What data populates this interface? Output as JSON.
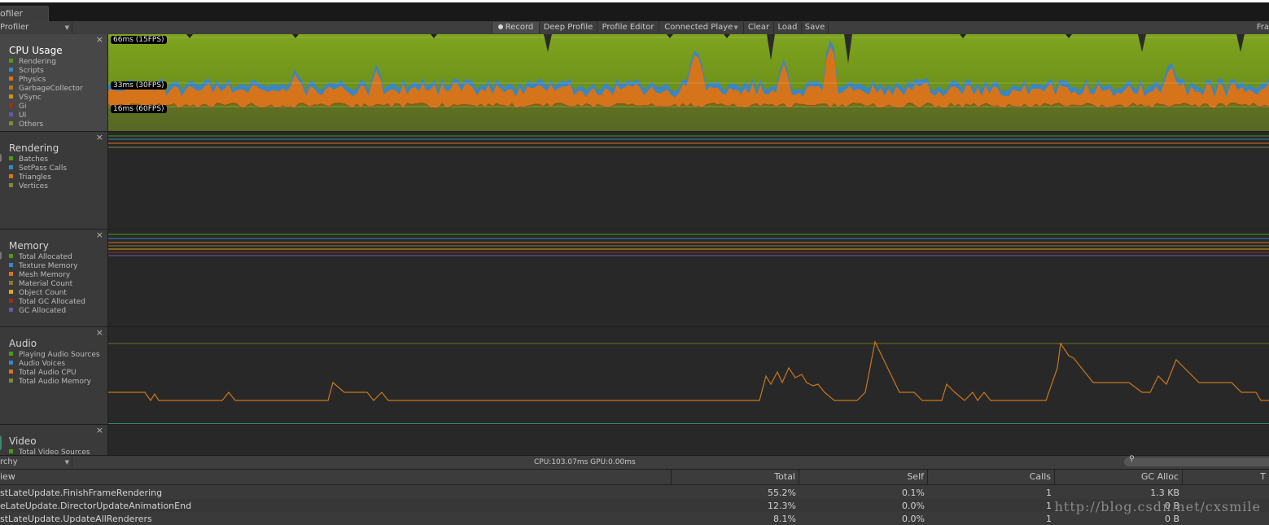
{
  "window": {
    "tab_title": "ofiler"
  },
  "toolbar": {
    "mode_dropdown": "Profiler",
    "record": "Record",
    "deep_profile": "Deep Profile",
    "profile_editor": "Profile Editor",
    "connected_player": "Connected Playe",
    "clear": "Clear",
    "load": "Load",
    "save": "Save",
    "frame_label": "Fra"
  },
  "lanes": [
    {
      "title": "CPU Usage",
      "selected": true,
      "legend": [
        {
          "label": "Rendering",
          "color": "#4c9a1c"
        },
        {
          "label": "Scripts",
          "color": "#3a86c4"
        },
        {
          "label": "Physics",
          "color": "#d6741b"
        },
        {
          "label": "GarbageCollector",
          "color": "#b07a20"
        },
        {
          "label": "VSync",
          "color": "#c9931a"
        },
        {
          "label": "Gi",
          "color": "#9c3018"
        },
        {
          "label": "UI",
          "color": "#6a56a8"
        },
        {
          "label": "Others",
          "color": "#7e8a38"
        }
      ],
      "fps_labels": [
        "66ms (15FPS)",
        "33ms (30FPS)",
        "16ms (60FPS)"
      ]
    },
    {
      "title": "Rendering",
      "selected": false,
      "legend": [
        {
          "label": "Batches",
          "color": "#4c9a1c"
        },
        {
          "label": "SetPass Calls",
          "color": "#3a86c4"
        },
        {
          "label": "Triangles",
          "color": "#d6741b"
        },
        {
          "label": "Vertices",
          "color": "#7e8a38"
        }
      ]
    },
    {
      "title": "Memory",
      "selected": false,
      "legend": [
        {
          "label": "Total Allocated",
          "color": "#4c9a1c"
        },
        {
          "label": "Texture Memory",
          "color": "#3a86c4"
        },
        {
          "label": "Mesh Memory",
          "color": "#d6741b"
        },
        {
          "label": "Material Count",
          "color": "#8a7a30"
        },
        {
          "label": "Object Count",
          "color": "#d8a81a"
        },
        {
          "label": "Total GC Allocated",
          "color": "#9c3018"
        },
        {
          "label": "GC Allocated",
          "color": "#6a56a8"
        }
      ]
    },
    {
      "title": "Audio",
      "selected": false,
      "legend": [
        {
          "label": "Playing Audio Sources",
          "color": "#4c9a1c"
        },
        {
          "label": "Audio Voices",
          "color": "#3a86c4"
        },
        {
          "label": "Total Audio CPU",
          "color": "#d6741b"
        },
        {
          "label": "Total Audio Memory",
          "color": "#7e8a38"
        }
      ]
    },
    {
      "title": "Video",
      "selected": false,
      "legend": [
        {
          "label": "Total Video Sources",
          "color": "#4c9a1c"
        }
      ]
    }
  ],
  "lane_close_glyph": "×",
  "hierarchy": {
    "view_dropdown": "rchy",
    "stats": "CPU:103.07ms   GPU:0.00ms",
    "search_placeholder": ""
  },
  "table": {
    "columns": [
      "iew",
      "Total",
      "Self",
      "Calls",
      "GC Alloc",
      "T"
    ],
    "rows": [
      {
        "name": "stLateUpdate.FinishFrameRendering",
        "total": "55.2%",
        "self": "0.1%",
        "calls": "1",
        "gc": "1.3 KB"
      },
      {
        "name": "eLateUpdate.DirectorUpdateAnimationEnd",
        "total": "12.3%",
        "self": "0.0%",
        "calls": "1",
        "gc": "0 B"
      },
      {
        "name": "stLateUpdate.UpdateAllRenderers",
        "total": "8.1%",
        "self": "0.0%",
        "calls": "1",
        "gc": "0 B"
      }
    ]
  },
  "watermark": "http://blog.csdn.net/cxsmile"
}
